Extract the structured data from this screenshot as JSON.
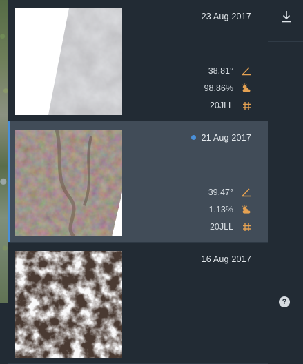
{
  "scenes": [
    {
      "date": "23 Aug 2017",
      "selected": false,
      "sun_elevation": "38.81°",
      "cloud_cover": "98.86%",
      "tile": "20JLL",
      "icons": {
        "angle": "angle-icon",
        "cloud": "sun-cloud-icon",
        "tile": "hash-icon"
      }
    },
    {
      "date": "21 Aug 2017",
      "selected": true,
      "sun_elevation": "39.47°",
      "cloud_cover": "1.13%",
      "tile": "20JLL",
      "icons": {
        "angle": "angle-icon",
        "cloud": "sun-cloud-icon",
        "tile": "hash-icon"
      }
    },
    {
      "date": "16 Aug 2017",
      "selected": false
    }
  ],
  "toolbar": {
    "download_icon": "download-icon",
    "help_icon": "help-icon",
    "help_label": "?"
  },
  "colors": {
    "accent": "#4a90d9",
    "icon": "#e4a152",
    "selected_bg": "#414c58",
    "panel_bg": "#222b34"
  }
}
